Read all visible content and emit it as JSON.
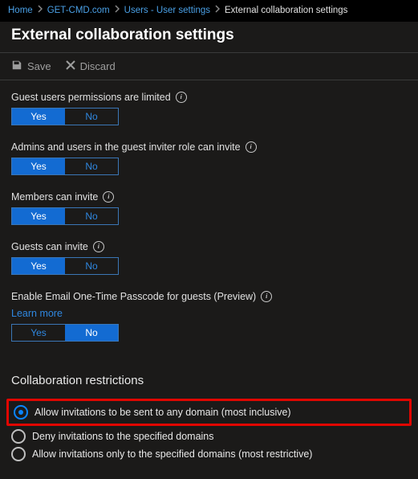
{
  "breadcrumbs": {
    "items": [
      {
        "label": "Home",
        "link": true
      },
      {
        "label": "GET-CMD.com",
        "link": true
      },
      {
        "label": "Users - User settings",
        "link": true
      },
      {
        "label": "External collaboration settings",
        "link": false
      }
    ]
  },
  "page": {
    "title": "External collaboration settings"
  },
  "toolbar": {
    "save": "Save",
    "discard": "Discard"
  },
  "settings": {
    "guest_limited": {
      "label": "Guest users permissions are limited",
      "yes": "Yes",
      "no": "No",
      "value": "yes"
    },
    "admins_invite": {
      "label": "Admins and users in the guest inviter role can invite",
      "yes": "Yes",
      "no": "No",
      "value": "yes"
    },
    "members_invite": {
      "label": "Members can invite",
      "yes": "Yes",
      "no": "No",
      "value": "yes"
    },
    "guests_invite": {
      "label": "Guests can invite",
      "yes": "Yes",
      "no": "No",
      "value": "yes"
    },
    "otp": {
      "label": "Enable Email One-Time Passcode for guests (Preview)",
      "learn_more": "Learn more",
      "yes": "Yes",
      "no": "No",
      "value": "no"
    }
  },
  "restrictions": {
    "heading": "Collaboration restrictions",
    "options": [
      {
        "label": "Allow invitations to be sent to any domain (most inclusive)",
        "checked": true,
        "highlight": true
      },
      {
        "label": "Deny invitations to the specified domains",
        "checked": false,
        "highlight": false
      },
      {
        "label": "Allow invitations only to the specified domains (most restrictive)",
        "checked": false,
        "highlight": false
      }
    ]
  }
}
